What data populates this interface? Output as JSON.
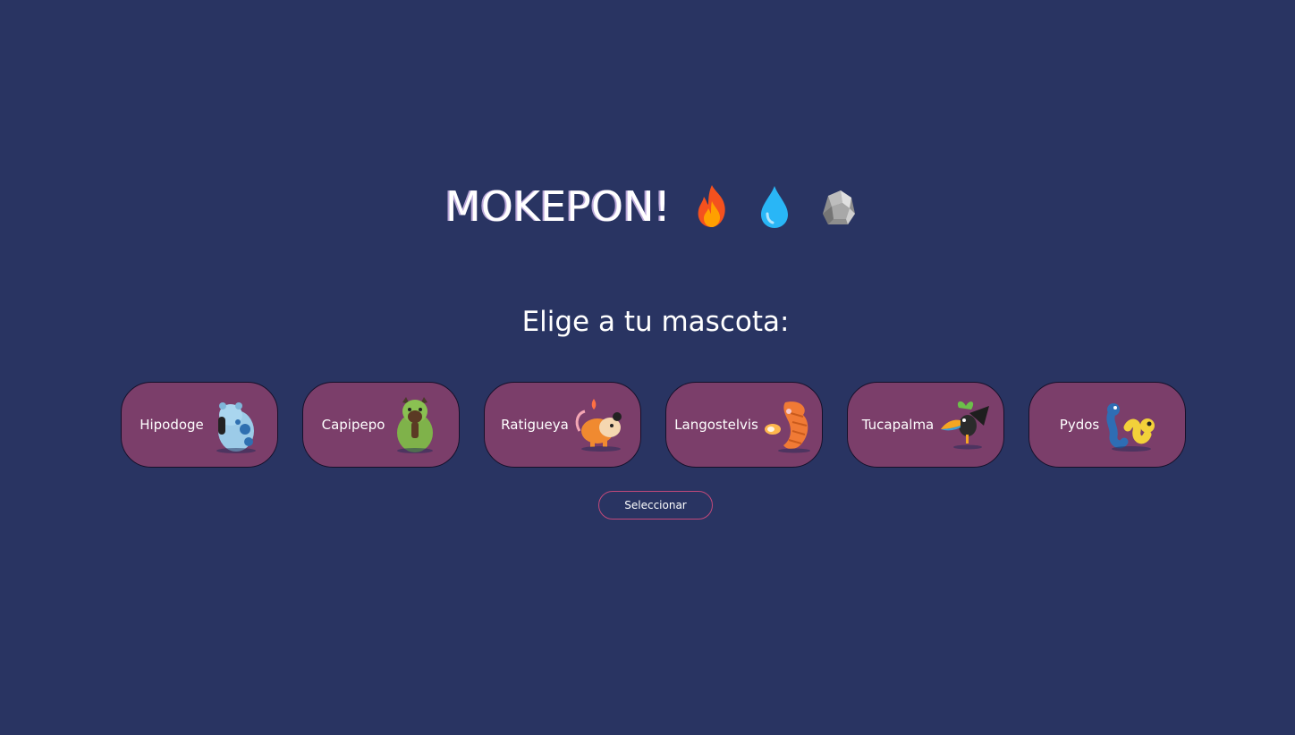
{
  "header": {
    "title": "MOKEPON!",
    "icons": [
      "fire-icon",
      "water-drop-icon",
      "rock-icon"
    ]
  },
  "main": {
    "subtitle": "Elige a tu mascota:",
    "pets": [
      {
        "label": "Hipodoge",
        "art": "hipodoge-art"
      },
      {
        "label": "Capipepo",
        "art": "capipepo-art"
      },
      {
        "label": "Ratigueya",
        "art": "ratigueya-art"
      },
      {
        "label": "Langostelvis",
        "art": "langostelvis-art"
      },
      {
        "label": "Tucapalma",
        "art": "tucapalma-art"
      },
      {
        "label": "Pydos",
        "art": "pydos-art"
      }
    ],
    "select_label": "Seleccionar"
  },
  "colors": {
    "background": "#293462",
    "card": "#7b3e6a",
    "card_border": "#15102a",
    "button_border": "#c2497a"
  }
}
